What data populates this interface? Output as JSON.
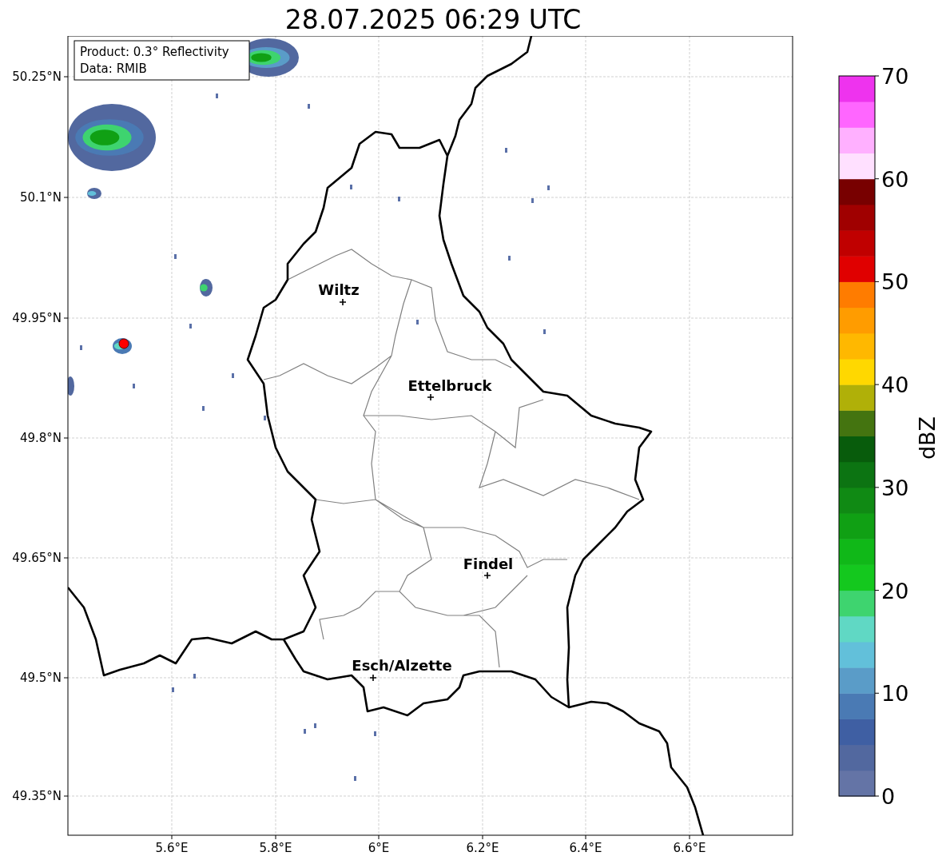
{
  "title": "28.07.2025 06:29 UTC",
  "info": {
    "product": "Product: 0.3° Reflectivity",
    "data": "Data: RMIB"
  },
  "lat_labels": [
    "50.25°N",
    "50.1°N",
    "49.95°N",
    "49.8°N",
    "49.65°N",
    "49.5°N",
    "49.35°N"
  ],
  "lon_labels": [
    "5.6°E",
    "5.8°E",
    "6°E",
    "6.2°E",
    "6.4°E",
    "6.6°E"
  ],
  "cities": [
    {
      "name": "Wiltz"
    },
    {
      "name": "Ettelbruck"
    },
    {
      "name": "Findel"
    },
    {
      "name": "Esch/Alzette"
    }
  ],
  "colorbar": {
    "label": "dBZ",
    "ticks": [
      "70",
      "60",
      "50",
      "40",
      "30",
      "20",
      "10",
      "0"
    ],
    "bands": [
      {
        "color": "#6474a6"
      },
      {
        "color": "#52689f"
      },
      {
        "color": "#3f5fa3"
      },
      {
        "color": "#4a7ab4"
      },
      {
        "color": "#5a9cc8"
      },
      {
        "color": "#62c0da"
      },
      {
        "color": "#60d8c4"
      },
      {
        "color": "#3ed46f"
      },
      {
        "color": "#14c81e"
      },
      {
        "color": "#10b818"
      },
      {
        "color": "#10a014"
      },
      {
        "color": "#108a14"
      },
      {
        "color": "#0c7412"
      },
      {
        "color": "#085c0c"
      },
      {
        "color": "#447410"
      },
      {
        "color": "#b0b008"
      },
      {
        "color": "#ffd800"
      },
      {
        "color": "#ffb800"
      },
      {
        "color": "#ff9c00"
      },
      {
        "color": "#ff7c00"
      },
      {
        "color": "#e00000"
      },
      {
        "color": "#c00000"
      },
      {
        "color": "#a00000"
      },
      {
        "color": "#780000"
      },
      {
        "color": "#ffe0ff"
      },
      {
        "color": "#ffb0ff"
      },
      {
        "color": "#ff66ff"
      },
      {
        "color": "#ee33ee"
      }
    ]
  }
}
